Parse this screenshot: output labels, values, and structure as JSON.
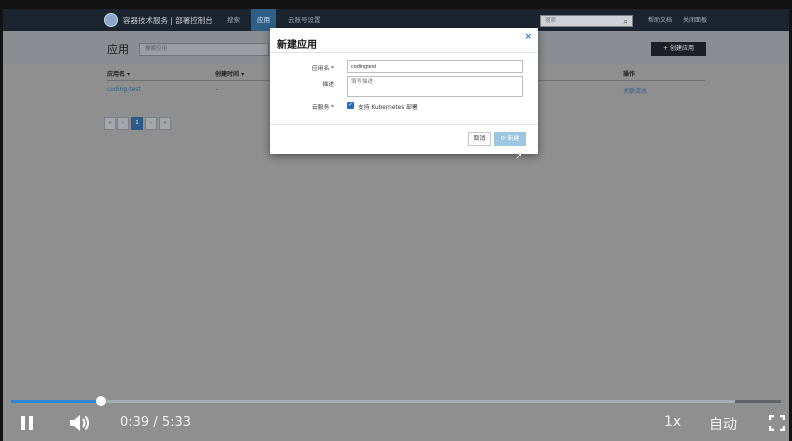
{
  "app": {
    "brand": "容器技术服务 | 部署控制台",
    "nav": [
      {
        "label": "搜索"
      },
      {
        "label": "应用",
        "active": true
      },
      {
        "label": "云账号设置"
      }
    ],
    "search_placeholder": "搜索",
    "links": [
      "帮助文档",
      "关闭面板"
    ]
  },
  "page": {
    "title": "应用",
    "search_placeholder": "搜索应用",
    "create_button": "+ 创建应用",
    "table": {
      "columns": [
        "应用名 ▾",
        "创建时间 ▾",
        "操作"
      ],
      "rows": [
        {
          "name": "coding-test",
          "created": "-",
          "action": "关联流水"
        }
      ]
    },
    "pagination": [
      "«",
      "‹",
      "1",
      "›",
      "»"
    ],
    "active_page": "1"
  },
  "modal": {
    "title": "新建应用",
    "close_label": "×",
    "fields": {
      "name_label": "应用名 *",
      "name_value": "codingtest",
      "desc_label": "描述",
      "desc_placeholder": "填写描述",
      "cloud_label": "云服务 *",
      "cloud_option": "支持 Kubernetes 部署"
    },
    "cancel_label": "取消",
    "submit_label": "⟳ 新建"
  },
  "player": {
    "time": "0:39 / 5:33",
    "progress_fraction": 0.117,
    "buffer_fraction": 0.94,
    "speed": "1x",
    "quality": "自动",
    "colors": {
      "played": "#2f86d6",
      "buffer": "#a5acb6"
    }
  }
}
